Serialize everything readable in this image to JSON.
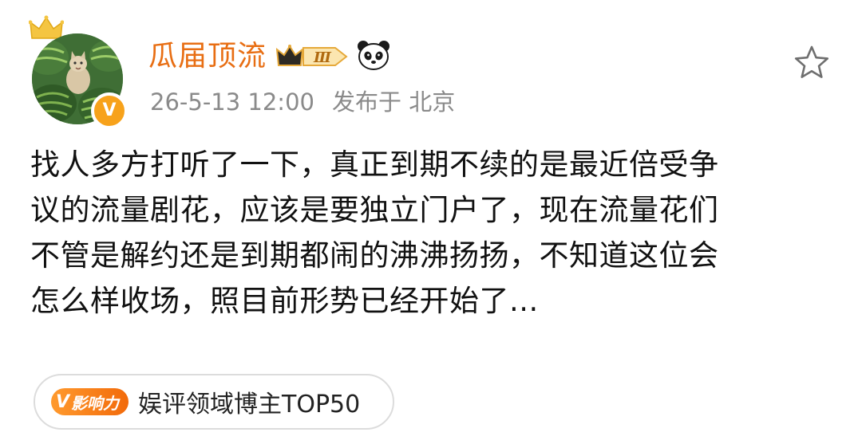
{
  "post": {
    "author": {
      "name": "瓜届顶流",
      "vip_level": "Ⅲ",
      "verified_mark": "V"
    },
    "meta": {
      "time": "26-5-13 12:00",
      "location": "发布于 北京"
    },
    "content_lines": [
      "找人多方打听了一下，真正到期不续的是最近倍受争",
      "议的流量剧花，应该是要独立门户了，现在流量花们",
      "不管是解约还是到期都闹的沸沸扬扬，不知道这位会",
      "怎么样收场，照目前形势已经开始了..."
    ],
    "influence": {
      "badge_mark": "V",
      "badge_label": "影响力",
      "text": "娱评领域博主TOP50"
    }
  },
  "icons": {
    "crown": "crown-icon",
    "verified": "verified-icon",
    "vip": "vip-crown-badge-icon",
    "panda": "panda-icon",
    "star": "star-outline-icon"
  },
  "colors": {
    "username": "#e86e13",
    "meta": "#8a8a8a",
    "body_text": "#111111",
    "badge_orange": "#f26a0a",
    "verified": "#f7a21b",
    "vip_gold": "#e6a93a"
  }
}
